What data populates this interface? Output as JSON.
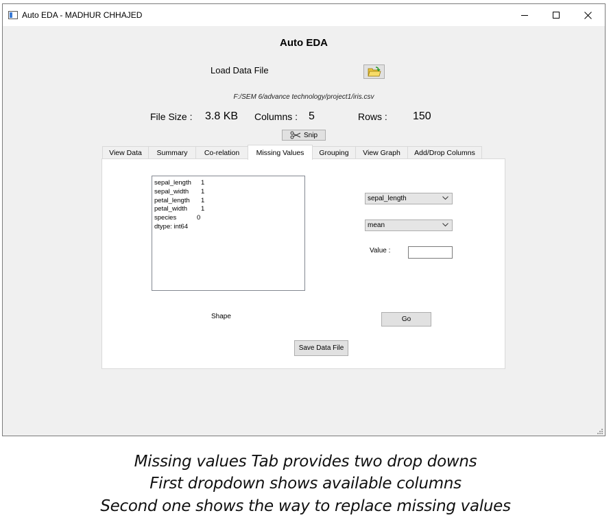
{
  "window": {
    "title": "Auto EDA - MADHUR CHHAJED"
  },
  "app": {
    "heading": "Auto EDA",
    "load_label": "Load Data File",
    "file_path": "F:/SEM 6/advance technology/project1/iris.csv",
    "file_size_label": "File Size :",
    "file_size_value": "3.8 KB",
    "columns_label": "Columns :",
    "columns_value": "5",
    "rows_label": "Rows :",
    "rows_value": "150",
    "snip_label": "Snip"
  },
  "tabs": [
    {
      "label": "View Data"
    },
    {
      "label": "Summary"
    },
    {
      "label": "Co-relation"
    },
    {
      "label": "Missing Values",
      "active": true
    },
    {
      "label": "Grouping"
    },
    {
      "label": "View Graph"
    },
    {
      "label": "Add/Drop Columns"
    }
  ],
  "missing_values": {
    "rows": [
      {
        "name": "sepal_length",
        "count": "1"
      },
      {
        "name": "sepal_width",
        "count": "1"
      },
      {
        "name": "petal_length",
        "count": "1"
      },
      {
        "name": "petal_width",
        "count": "1"
      },
      {
        "name": "species",
        "count": "0"
      }
    ],
    "dtype": "dtype: int64",
    "column_dropdown": "sepal_length",
    "method_dropdown": "mean",
    "value_label": "Value :",
    "value_input": "",
    "shape_label": "Shape",
    "go_label": "Go",
    "save_label": "Save Data File"
  },
  "caption": {
    "line1": "Missing values Tab provides two drop downs",
    "line2": "First dropdown shows available columns",
    "line3": "Second one shows the way to replace missing values"
  }
}
